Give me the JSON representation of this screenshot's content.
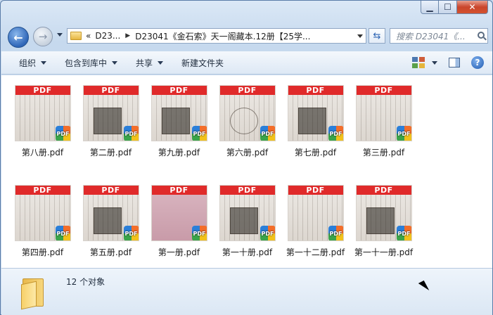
{
  "window": {
    "controls": {
      "minimize": "▁",
      "maximize": "☐",
      "close": "✕"
    }
  },
  "address": {
    "chevron": "«",
    "crumb1": "D23...",
    "crumb2": "D23041《金石索》天一阁藏本.12册【25学..."
  },
  "search": {
    "placeholder": "搜索 D23041《..."
  },
  "toolbar": {
    "organize": "组织",
    "include_library": "包含到库中",
    "share": "共享",
    "new_folder": "新建文件夹"
  },
  "files": [
    {
      "name": "第八册.pdf",
      "band": "PDF",
      "style": "plain"
    },
    {
      "name": "第二册.pdf",
      "band": "PDF",
      "style": "dark"
    },
    {
      "name": "第九册.pdf",
      "band": "PDF",
      "style": "dark"
    },
    {
      "name": "第六册.pdf",
      "band": "PDF",
      "style": "circle"
    },
    {
      "name": "第七册.pdf",
      "band": "PDF",
      "style": "dark"
    },
    {
      "name": "第三册.pdf",
      "band": "PDF",
      "style": "plain"
    },
    {
      "name": "第四册.pdf",
      "band": "PDF",
      "style": "plain"
    },
    {
      "name": "第五册.pdf",
      "band": "PDF",
      "style": "dark"
    },
    {
      "name": "第一册.pdf",
      "band": "PDF",
      "style": "pink"
    },
    {
      "name": "第一十册.pdf",
      "band": "PDF",
      "style": "dark"
    },
    {
      "name": "第一十二册.pdf",
      "band": "PDF",
      "style": "plain"
    },
    {
      "name": "第一十一册.pdf",
      "band": "PDF",
      "style": "dark"
    }
  ],
  "badge_label": "PDF",
  "status": {
    "count": "12 个对象"
  }
}
